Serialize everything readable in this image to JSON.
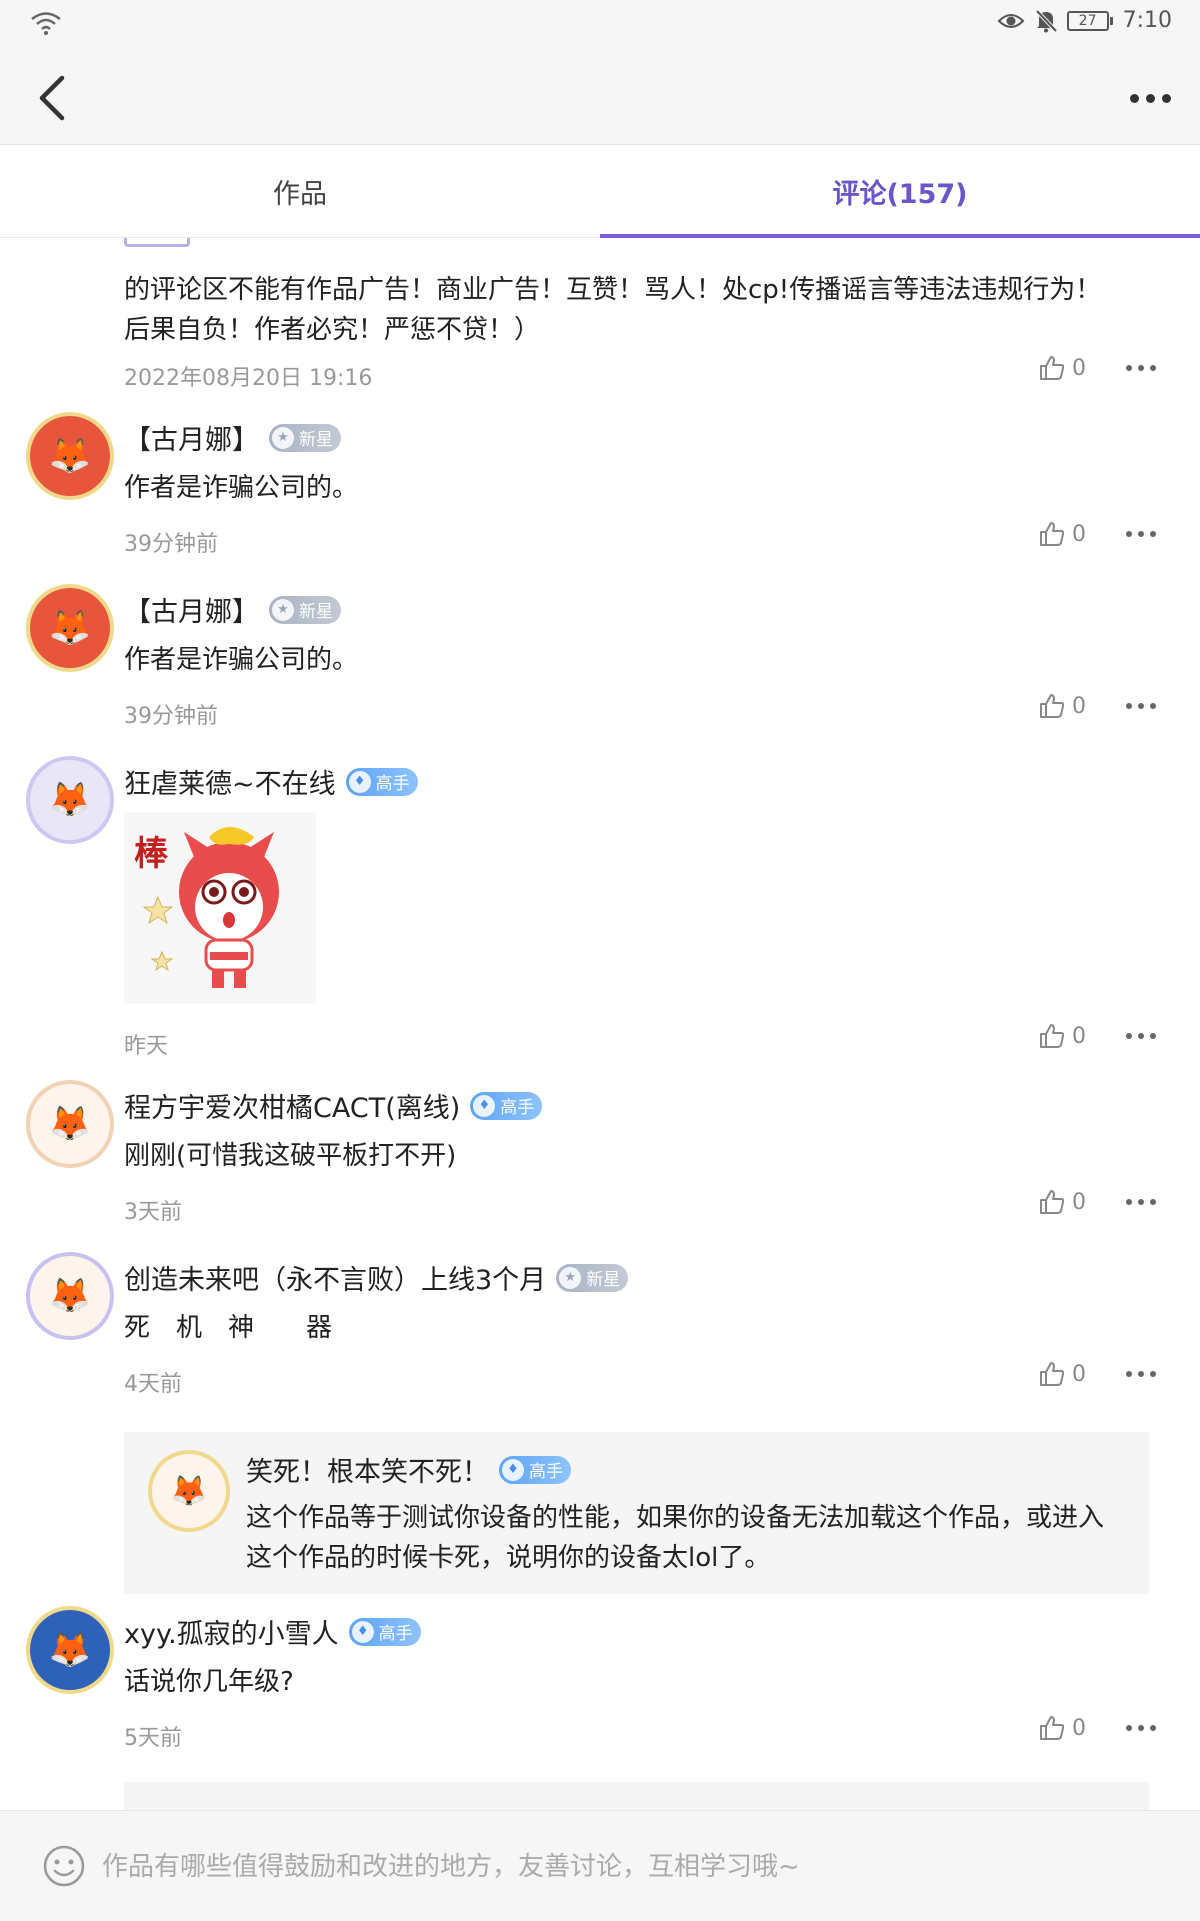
{
  "status_bar": {
    "time": "7:10",
    "battery": "27"
  },
  "tabs": [
    {
      "label": "作品"
    },
    {
      "label": "评论(157)"
    }
  ],
  "comments": [
    {
      "text": "的评论区不能有作品广告！商业广告！互赞！骂人！处cp!传播谣言等违法违规行为！后果自负！作者必究！严惩不贷！）",
      "time": "2022年08月20日 19:16",
      "likes": "0"
    },
    {
      "username": "【古月娜】",
      "badge": "新星",
      "text": "作者是诈骗公司的。",
      "time": "39分钟前",
      "likes": "0"
    },
    {
      "username": "【古月娜】",
      "badge": "新星",
      "text": "作者是诈骗公司的。",
      "time": "39分钟前",
      "likes": "0"
    },
    {
      "username": "狂虐莱德~不在线",
      "badge": "高手",
      "sticker_text": "棒",
      "time": "昨天",
      "likes": "0"
    },
    {
      "username": "程方宇爱次柑橘CACT(离线)",
      "badge": "高手",
      "text": "刚刚(可惜我这破平板打不开)",
      "time": "3天前",
      "likes": "0"
    },
    {
      "username": "创造未来吧（永不言败）上线3个月",
      "badge": "新星",
      "text": "死　机　神　　器",
      "time": "4天前",
      "likes": "0",
      "reply": {
        "username": "笑死！根本笑不死！",
        "badge": "高手",
        "text": "这个作品等于测试你设备的性能，如果你的设备无法加载这个作品，或进入这个作品的时候卡死，说明你的设备太lol了。"
      }
    },
    {
      "username": "xyy.孤寂的小雪人",
      "badge": "高手",
      "text": "话说你几年级?",
      "time": "5天前",
      "likes": "0"
    }
  ],
  "input": {
    "placeholder": "作品有哪些值得鼓励和改进的地方，友善讨论，互相学习哦~"
  },
  "colors": {
    "accent": "#6b55c7",
    "badge_blue": "#5ea3f5",
    "badge_gray": "#a9b3c4"
  },
  "icons": [
    "wifi-icon",
    "eye-icon",
    "mute-bell-icon",
    "battery-icon",
    "back-arrow-icon",
    "more-icon",
    "thumbs-up-icon",
    "emoji-icon"
  ]
}
